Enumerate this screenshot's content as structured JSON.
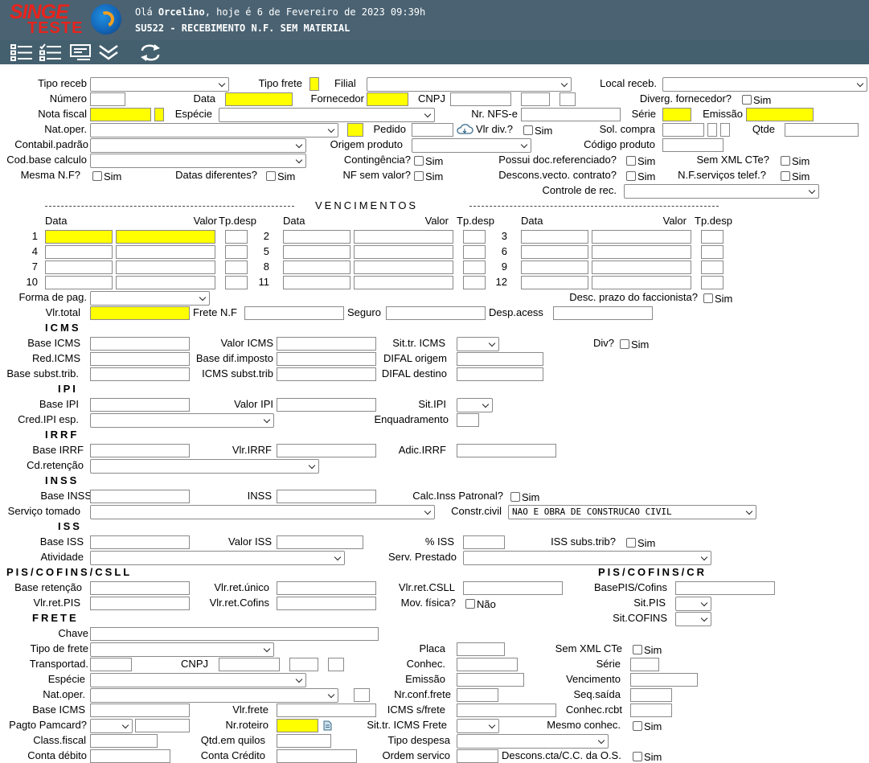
{
  "header": {
    "logo_line1": "SINGE",
    "logo_line2": "TESTE",
    "greeting_prefix": "Olá",
    "user": "Orcelino",
    "greeting_suffix": ", hoje é 6 de Fevereiro de 2023 09:39h",
    "program": "SU522 - RECEBIMENTO N.F. SEM MATERIAL"
  },
  "toolbar": {
    "icons": [
      "list-icon",
      "checklist-icon",
      "card-icon",
      "double-chevron-icon",
      "refresh-icon"
    ]
  },
  "colors": {
    "header_bg": "#4a6272",
    "toolbar_bg": "#44606f",
    "required_field": "#ffff00",
    "logo": "#e8231c"
  },
  "labels": {
    "tipo_receb": "Tipo receb",
    "tipo_frete": "Tipo frete",
    "filial": "Filial",
    "local_receb": "Local receb.",
    "numero": "Número",
    "data": "Data",
    "fornecedor": "Fornecedor",
    "cnpj": "CNPJ",
    "diverg_fornecedor": "Diverg. fornecedor?",
    "nota_fiscal": "Nota fiscal",
    "especie": "Espécie",
    "nr_nfse": "Nr. NFS-e",
    "serie": "Série",
    "emissao": "Emissão",
    "nat_oper": "Nat.oper.",
    "pedido": "Pedido",
    "vlr_div": "Vlr div.?",
    "sol_compra": "Sol. compra",
    "qtde": "Qtde",
    "contabil_padrao": "Contabil.padrão",
    "origem_produto": "Origem produto",
    "codigo_produto": "Código produto",
    "cod_base_calculo": "Cod.base calculo",
    "contingencia": "Contingência?",
    "possui_doc": "Possui doc.referenciado?",
    "sem_xml_cte": "Sem XML CTe?",
    "mesma_nf": "Mesma N.F?",
    "datas_diferentes": "Datas diferentes?",
    "nf_sem_valor": "NF sem valor?",
    "descons_vecto": "Descons.vecto. contrato?",
    "nf_servicos": "N.F.serviços telef.?",
    "controle_rec": "Controle de rec.",
    "sim": "Sim",
    "nao": "Não"
  },
  "vencimentos": {
    "title": "VENCIMENTOS",
    "col_data": "Data",
    "col_valor": "Valor",
    "col_tpdesp": "Tp.desp",
    "rows": [
      "1",
      "2",
      "3",
      "4",
      "5",
      "6",
      "7",
      "8",
      "9",
      "10",
      "11",
      "12"
    ]
  },
  "totais": {
    "forma_pag": "Forma de pag.",
    "desc_prazo": "Desc. prazo do faccionista?",
    "vlr_total": "Vlr.total",
    "frete_nf": "Frete N.F",
    "seguro": "Seguro",
    "desp_acess": "Desp.acess"
  },
  "icms": {
    "title": "ICMS",
    "base_icms": "Base ICMS",
    "valor_icms": "Valor ICMS",
    "sit_tr_icms": "Sit.tr. ICMS",
    "div": "Div?",
    "red_icms": "Red.ICMS",
    "base_dif_imposto": "Base dif.imposto",
    "difal_origem": "DIFAL origem",
    "base_subst_trib": "Base subst.trib.",
    "icms_subst_trib": "ICMS subst.trib",
    "difal_destino": "DIFAL destino"
  },
  "ipi": {
    "title": "IPI",
    "base_ipi": "Base IPI",
    "valor_ipi": "Valor IPI",
    "sit_ipi": "Sit.IPI",
    "cred_ipi_esp": "Cred.IPI esp.",
    "enquadramento": "Enquadramento"
  },
  "irrf": {
    "title": "IRRF",
    "base_irrf": "Base IRRF",
    "vlr_irrf": "Vlr.IRRF",
    "adic_irrf": "Adic.IRRF",
    "cd_retencao": "Cd.retenção"
  },
  "inss": {
    "title": "INSS",
    "base_inss": "Base INSS",
    "inss": "INSS",
    "calc_inss_patronal": "Calc.Inss Patronal?",
    "servico_tomado": "Serviço tomado",
    "constr_civil": "Constr.civil",
    "constr_civil_value": "NAO E OBRA DE CONSTRUCAO CIVIL"
  },
  "iss": {
    "title": "ISS",
    "base_iss": "Base ISS",
    "valor_iss": "Valor ISS",
    "perc_iss": "% ISS",
    "iss_subs_trib": "ISS subs.trib?",
    "atividade": "Atividade",
    "serv_prestado": "Serv. Prestado"
  },
  "pis": {
    "title": "PIS/COFINS/CSLL",
    "title_cr": "PIS/COFINS/CR",
    "base_retencao": "Base retenção",
    "vlr_ret_unico": "Vlr.ret.único",
    "vlr_ret_csll": "Vlr.ret.CSLL",
    "base_pis_cofins": "BasePIS/Cofins",
    "vlr_ret_pis": "Vlr.ret.PIS",
    "vlr_ret_cofins": "Vlr.ret.Cofins",
    "mov_fisica": "Mov. física?",
    "sit_pis": "Sit.PIS",
    "sit_cofins": "Sit.COFINS"
  },
  "frete": {
    "title": "FRETE",
    "chave": "Chave",
    "tipo_frete": "Tipo de frete",
    "placa": "Placa",
    "sem_xml_cte": "Sem XML CTe",
    "transportad": "Transportad.",
    "cnpj": "CNPJ",
    "conhec": "Conhec.",
    "serie": "Série",
    "especie": "Espécie",
    "emissao": "Emissão",
    "vencimento": "Vencimento",
    "nat_oper": "Nat.oper.",
    "nr_conf_frete": "Nr.conf.frete",
    "seq_saida": "Seq.saída",
    "base_icms": "Base ICMS",
    "vlr_frete": "Vlr.frete",
    "icms_s_frete": "ICMS s/frete",
    "conhec_rcbt": "Conhec.rcbt",
    "pagto_pamcard": "Pagto Pamcard?",
    "nr_roteiro": "Nr.roteiro",
    "sit_tr_icms_frete": "Sit.tr. ICMS Frete",
    "mesmo_conhec": "Mesmo conhec.",
    "class_fiscal": "Class.fiscal",
    "qtd_em_quilos": "Qtd.em quilos",
    "tipo_despesa": "Tipo despesa",
    "conta_debito": "Conta débito",
    "conta_credito": "Conta Crédito",
    "ordem_servico": "Ordem servico",
    "descons_cta": "Descons.cta/C.C. da O.S."
  }
}
